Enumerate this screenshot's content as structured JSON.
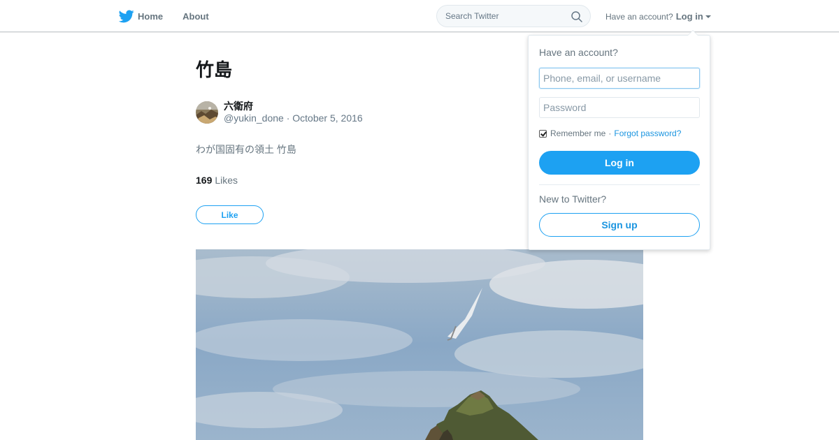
{
  "nav": {
    "home_label": "Home",
    "about_label": "About",
    "search_placeholder": "Search Twitter",
    "have_account_label": "Have an account?",
    "login_label": "Log in"
  },
  "tweet": {
    "title": "竹島",
    "author_name": "六衛府",
    "author_handle": "@yukin_done",
    "separator": " · ",
    "date": "October 5, 2016",
    "text": "わが国固有の領土 竹島",
    "likes_count": "169",
    "likes_label": "Likes",
    "like_button_label": "Like"
  },
  "login_dropdown": {
    "heading": "Have an account?",
    "username_placeholder": "Phone, email, or username",
    "password_placeholder": "Password",
    "remember_label": "Remember me",
    "remember_checked": true,
    "separator": "·",
    "forgot_label": "Forgot password?",
    "login_button_label": "Log in",
    "new_heading": "New to Twitter?",
    "signup_button_label": "Sign up"
  },
  "colors": {
    "brand": "#1da1f2",
    "link": "#1b95e0",
    "muted": "#66757f",
    "text": "#14171a"
  }
}
